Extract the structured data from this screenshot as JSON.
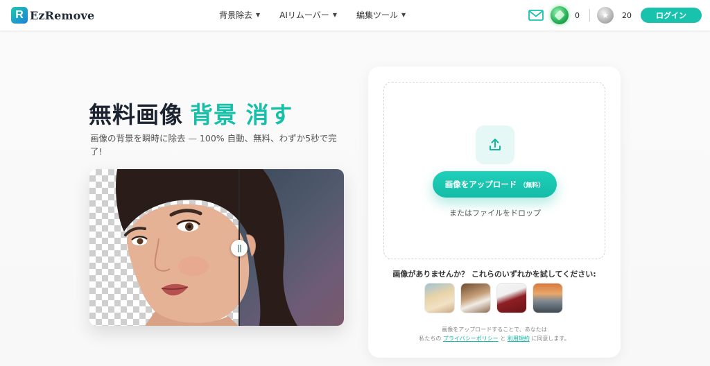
{
  "app": {
    "name": "EzRemove",
    "logo_letter": "R"
  },
  "nav": [
    {
      "label": "背景除去"
    },
    {
      "label": "AIリムーバー"
    },
    {
      "label": "編集ツール"
    }
  ],
  "header": {
    "gem_count": "0",
    "credit_count": "20",
    "login_label": "ログイン"
  },
  "hero": {
    "title_main": "無料画像",
    "title_accent": "背景 消す",
    "subtitle": "画像の背景を瞬時に除去 — 100% 自動、無料、わずか5秒で完了!"
  },
  "upload": {
    "button_label": "画像をアップロード",
    "button_free": "（無料）",
    "drop_text": "またはファイルをドロップ"
  },
  "samples": {
    "label": "画像がありませんか？ これらのいずれかを試してください:",
    "items": [
      "sample-woman",
      "sample-dog",
      "sample-handbag",
      "sample-car"
    ]
  },
  "consent": {
    "line1": "画像をアップロードすることで、あなたは",
    "prefix": "私たちの",
    "privacy": "プライバシーポリシー",
    "and": "と",
    "terms": "利用規約",
    "suffix": "に同意します。"
  },
  "colors": {
    "accent": "#19c2ad",
    "dark": "#1c2331"
  },
  "icons": [
    "mail-icon",
    "gem-icon",
    "star-coin-icon",
    "upload-icon",
    "chevron-down-icon"
  ]
}
